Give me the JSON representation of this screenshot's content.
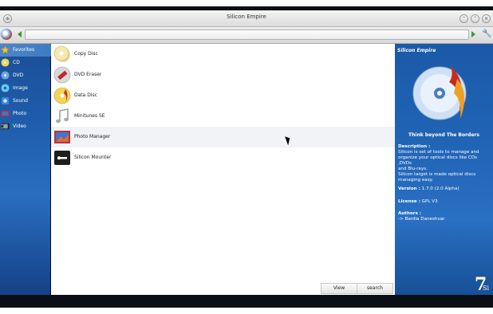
{
  "window": {
    "title": "Silicon Empire"
  },
  "sidebar": {
    "items": [
      {
        "label": "Favorites",
        "icon": "star-icon",
        "color": "#f1c232",
        "active": true
      },
      {
        "label": "CD",
        "icon": "cd-icon",
        "color": "#f3d45a"
      },
      {
        "label": "DVD",
        "icon": "dvd-icon",
        "color": "#6da8e8"
      },
      {
        "label": "Image",
        "icon": "image-icon",
        "color": "#6ec8f2"
      },
      {
        "label": "Sound",
        "icon": "sound-icon",
        "color": "#3b86d8"
      },
      {
        "label": "Photo",
        "icon": "photo-icon",
        "color": "#b6343c"
      },
      {
        "label": "Video",
        "icon": "video-icon",
        "color": "#333333"
      }
    ]
  },
  "main": {
    "items": [
      {
        "label": "Copy Disc",
        "icon": "copy-disc-icon"
      },
      {
        "label": "DVD Eraser",
        "icon": "dvd-eraser-icon"
      },
      {
        "label": "Data Disc",
        "icon": "data-disc-icon"
      },
      {
        "label": "Minitunes SE",
        "icon": "music-note-icon"
      },
      {
        "label": "Photo Manager",
        "icon": "photo-manager-icon"
      },
      {
        "label": "Silicon Mounter",
        "icon": "mounter-icon"
      }
    ],
    "view_label": "View",
    "search_label": "search"
  },
  "info": {
    "title": "Silicon Empire",
    "tagline": "Think beyond The Borders",
    "description_label": "Description :",
    "description_lines": [
      "Silicon is set of tools to manage and",
      "organize your optical discs like CDs ,DVDs",
      "and Blu-rays.",
      "Silicon target is made optical discs",
      "managing easy."
    ],
    "version_label": "Version :",
    "version_value": "1.7.0 (2.0 Alpha)",
    "license_label": "License :",
    "license_value": "GPL V3",
    "authors_label": "Authors :",
    "authors_value": "-> Bardia Daneshvar",
    "logo_text": "7",
    "logo_sub": "Si"
  },
  "colors": {
    "sidebar_blue": "#1e5cab",
    "accent_green": "#3a9a25",
    "row_hover": "#f1f3f6"
  }
}
